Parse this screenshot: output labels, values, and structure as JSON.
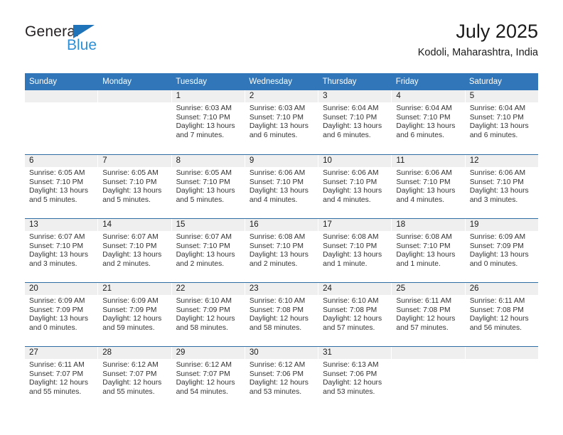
{
  "brand": {
    "name_part1": "General",
    "name_part2": "Blue"
  },
  "header": {
    "title": "July 2025",
    "subtitle": "Kodoli, Maharashtra, India"
  },
  "colors": {
    "header_blue": "#3076b8",
    "grid_line": "#2e6da4",
    "day_band": "#efefef",
    "logo_blue": "#2d8fd5"
  },
  "weekdays": [
    "Sunday",
    "Monday",
    "Tuesday",
    "Wednesday",
    "Thursday",
    "Friday",
    "Saturday"
  ],
  "weeks": [
    [
      {
        "day": "",
        "sunrise": "",
        "sunset": "",
        "daylight": ""
      },
      {
        "day": "",
        "sunrise": "",
        "sunset": "",
        "daylight": ""
      },
      {
        "day": "1",
        "sunrise": "Sunrise: 6:03 AM",
        "sunset": "Sunset: 7:10 PM",
        "daylight": "Daylight: 13 hours and 7 minutes."
      },
      {
        "day": "2",
        "sunrise": "Sunrise: 6:03 AM",
        "sunset": "Sunset: 7:10 PM",
        "daylight": "Daylight: 13 hours and 6 minutes."
      },
      {
        "day": "3",
        "sunrise": "Sunrise: 6:04 AM",
        "sunset": "Sunset: 7:10 PM",
        "daylight": "Daylight: 13 hours and 6 minutes."
      },
      {
        "day": "4",
        "sunrise": "Sunrise: 6:04 AM",
        "sunset": "Sunset: 7:10 PM",
        "daylight": "Daylight: 13 hours and 6 minutes."
      },
      {
        "day": "5",
        "sunrise": "Sunrise: 6:04 AM",
        "sunset": "Sunset: 7:10 PM",
        "daylight": "Daylight: 13 hours and 6 minutes."
      }
    ],
    [
      {
        "day": "6",
        "sunrise": "Sunrise: 6:05 AM",
        "sunset": "Sunset: 7:10 PM",
        "daylight": "Daylight: 13 hours and 5 minutes."
      },
      {
        "day": "7",
        "sunrise": "Sunrise: 6:05 AM",
        "sunset": "Sunset: 7:10 PM",
        "daylight": "Daylight: 13 hours and 5 minutes."
      },
      {
        "day": "8",
        "sunrise": "Sunrise: 6:05 AM",
        "sunset": "Sunset: 7:10 PM",
        "daylight": "Daylight: 13 hours and 5 minutes."
      },
      {
        "day": "9",
        "sunrise": "Sunrise: 6:06 AM",
        "sunset": "Sunset: 7:10 PM",
        "daylight": "Daylight: 13 hours and 4 minutes."
      },
      {
        "day": "10",
        "sunrise": "Sunrise: 6:06 AM",
        "sunset": "Sunset: 7:10 PM",
        "daylight": "Daylight: 13 hours and 4 minutes."
      },
      {
        "day": "11",
        "sunrise": "Sunrise: 6:06 AM",
        "sunset": "Sunset: 7:10 PM",
        "daylight": "Daylight: 13 hours and 4 minutes."
      },
      {
        "day": "12",
        "sunrise": "Sunrise: 6:06 AM",
        "sunset": "Sunset: 7:10 PM",
        "daylight": "Daylight: 13 hours and 3 minutes."
      }
    ],
    [
      {
        "day": "13",
        "sunrise": "Sunrise: 6:07 AM",
        "sunset": "Sunset: 7:10 PM",
        "daylight": "Daylight: 13 hours and 3 minutes."
      },
      {
        "day": "14",
        "sunrise": "Sunrise: 6:07 AM",
        "sunset": "Sunset: 7:10 PM",
        "daylight": "Daylight: 13 hours and 2 minutes."
      },
      {
        "day": "15",
        "sunrise": "Sunrise: 6:07 AM",
        "sunset": "Sunset: 7:10 PM",
        "daylight": "Daylight: 13 hours and 2 minutes."
      },
      {
        "day": "16",
        "sunrise": "Sunrise: 6:08 AM",
        "sunset": "Sunset: 7:10 PM",
        "daylight": "Daylight: 13 hours and 2 minutes."
      },
      {
        "day": "17",
        "sunrise": "Sunrise: 6:08 AM",
        "sunset": "Sunset: 7:10 PM",
        "daylight": "Daylight: 13 hours and 1 minute."
      },
      {
        "day": "18",
        "sunrise": "Sunrise: 6:08 AM",
        "sunset": "Sunset: 7:10 PM",
        "daylight": "Daylight: 13 hours and 1 minute."
      },
      {
        "day": "19",
        "sunrise": "Sunrise: 6:09 AM",
        "sunset": "Sunset: 7:09 PM",
        "daylight": "Daylight: 13 hours and 0 minutes."
      }
    ],
    [
      {
        "day": "20",
        "sunrise": "Sunrise: 6:09 AM",
        "sunset": "Sunset: 7:09 PM",
        "daylight": "Daylight: 13 hours and 0 minutes."
      },
      {
        "day": "21",
        "sunrise": "Sunrise: 6:09 AM",
        "sunset": "Sunset: 7:09 PM",
        "daylight": "Daylight: 12 hours and 59 minutes."
      },
      {
        "day": "22",
        "sunrise": "Sunrise: 6:10 AM",
        "sunset": "Sunset: 7:09 PM",
        "daylight": "Daylight: 12 hours and 58 minutes."
      },
      {
        "day": "23",
        "sunrise": "Sunrise: 6:10 AM",
        "sunset": "Sunset: 7:08 PM",
        "daylight": "Daylight: 12 hours and 58 minutes."
      },
      {
        "day": "24",
        "sunrise": "Sunrise: 6:10 AM",
        "sunset": "Sunset: 7:08 PM",
        "daylight": "Daylight: 12 hours and 57 minutes."
      },
      {
        "day": "25",
        "sunrise": "Sunrise: 6:11 AM",
        "sunset": "Sunset: 7:08 PM",
        "daylight": "Daylight: 12 hours and 57 minutes."
      },
      {
        "day": "26",
        "sunrise": "Sunrise: 6:11 AM",
        "sunset": "Sunset: 7:08 PM",
        "daylight": "Daylight: 12 hours and 56 minutes."
      }
    ],
    [
      {
        "day": "27",
        "sunrise": "Sunrise: 6:11 AM",
        "sunset": "Sunset: 7:07 PM",
        "daylight": "Daylight: 12 hours and 55 minutes."
      },
      {
        "day": "28",
        "sunrise": "Sunrise: 6:12 AM",
        "sunset": "Sunset: 7:07 PM",
        "daylight": "Daylight: 12 hours and 55 minutes."
      },
      {
        "day": "29",
        "sunrise": "Sunrise: 6:12 AM",
        "sunset": "Sunset: 7:07 PM",
        "daylight": "Daylight: 12 hours and 54 minutes."
      },
      {
        "day": "30",
        "sunrise": "Sunrise: 6:12 AM",
        "sunset": "Sunset: 7:06 PM",
        "daylight": "Daylight: 12 hours and 53 minutes."
      },
      {
        "day": "31",
        "sunrise": "Sunrise: 6:13 AM",
        "sunset": "Sunset: 7:06 PM",
        "daylight": "Daylight: 12 hours and 53 minutes."
      },
      {
        "day": "",
        "sunrise": "",
        "sunset": "",
        "daylight": ""
      },
      {
        "day": "",
        "sunrise": "",
        "sunset": "",
        "daylight": ""
      }
    ]
  ]
}
